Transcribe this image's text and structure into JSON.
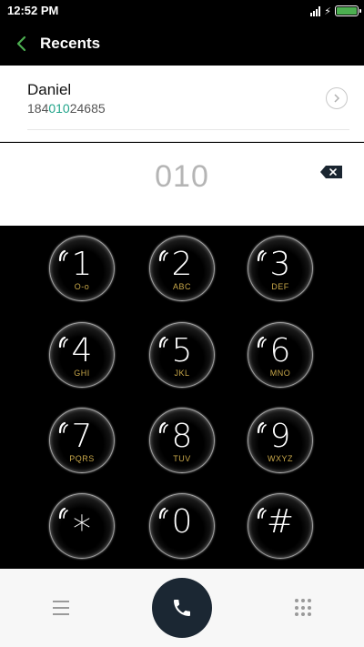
{
  "status": {
    "time": "12:52 PM",
    "battery_color": "#4caf50"
  },
  "header": {
    "title": "Recents",
    "back_icon": "chevron-left-icon",
    "accent": "#4caf50"
  },
  "contact": {
    "name": "Daniel",
    "number_prefix": "184",
    "number_match": "010",
    "number_suffix": "24685",
    "match_color": "#21a48a"
  },
  "input": {
    "value": "010"
  },
  "keys": [
    {
      "digit": "1",
      "letters": "O-o"
    },
    {
      "digit": "2",
      "letters": "ABC"
    },
    {
      "digit": "3",
      "letters": "DEF"
    },
    {
      "digit": "4",
      "letters": "GHI"
    },
    {
      "digit": "5",
      "letters": "JKL"
    },
    {
      "digit": "6",
      "letters": "MNO"
    },
    {
      "digit": "7",
      "letters": "PQRS"
    },
    {
      "digit": "8",
      "letters": "TUV"
    },
    {
      "digit": "9",
      "letters": "WXYZ"
    },
    {
      "digit": "*",
      "letters": ""
    },
    {
      "digit": "0",
      "letters": ""
    },
    {
      "digit": "#",
      "letters": ""
    }
  ],
  "bottom": {
    "call_button_color": "#1b2733"
  }
}
